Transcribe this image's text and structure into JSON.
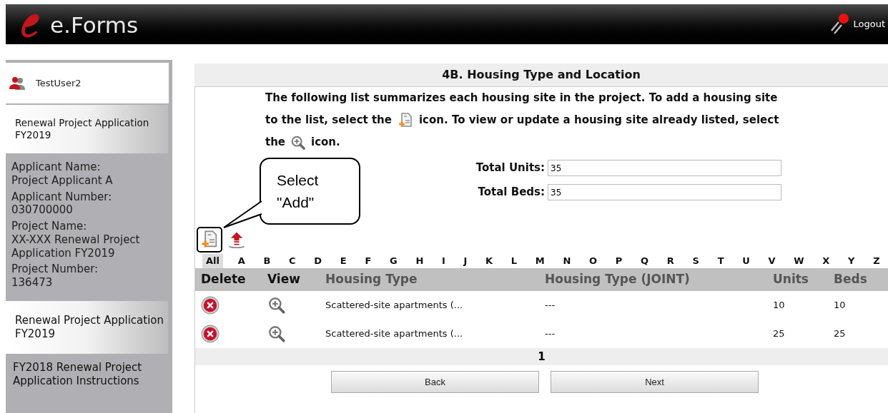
{
  "header": {
    "brand": "e.Forms",
    "logout": "Logout"
  },
  "sidebar": {
    "user": "TestUser2",
    "items": [
      {
        "kind": "link",
        "label": "Renewal Project Application FY2019"
      },
      {
        "kind": "info",
        "fields": [
          {
            "label": "Applicant Name:",
            "value": "Project Applicant A"
          },
          {
            "label": "Applicant Number:",
            "value": "030700000"
          },
          {
            "label": "Project Name:",
            "value": "XX-XXX Renewal Project Application FY2019"
          },
          {
            "label": "Project Number:",
            "value": "136473"
          }
        ]
      },
      {
        "kind": "link",
        "label": "Renewal Project Application FY2019"
      },
      {
        "kind": "plain",
        "label": "FY2018 Renewal Project Application Instructions"
      }
    ]
  },
  "main": {
    "title": "4B. Housing Type and Location",
    "intro": [
      [
        {
          "kind": "text",
          "text": "The following list summarizes each housing site in the project. To add a housing site"
        }
      ],
      [
        {
          "kind": "text",
          "text": "to the list, select the"
        },
        {
          "kind": "add_icon"
        },
        {
          "kind": "text",
          "text": "icon. To view or update a housing site already listed, select"
        }
      ],
      [
        {
          "kind": "text",
          "text": "the"
        },
        {
          "kind": "zoom_icon"
        },
        {
          "kind": "text",
          "text": "icon."
        }
      ]
    ],
    "totals": [
      {
        "label": "Total Units:",
        "value": "35"
      },
      {
        "label": "Total Beds:",
        "value": "35"
      }
    ],
    "callout": "Select \"Add\"",
    "letters": [
      {
        "label": "All",
        "selected": true
      },
      {
        "label": "A",
        "selected": false
      },
      {
        "label": "B",
        "selected": false
      },
      {
        "label": "C",
        "selected": false
      },
      {
        "label": "D",
        "selected": false
      },
      {
        "label": "E",
        "selected": false
      },
      {
        "label": "F",
        "selected": false
      },
      {
        "label": "G",
        "selected": false
      },
      {
        "label": "H",
        "selected": false
      },
      {
        "label": "I",
        "selected": false
      },
      {
        "label": "J",
        "selected": false
      },
      {
        "label": "K",
        "selected": false
      },
      {
        "label": "L",
        "selected": false
      },
      {
        "label": "M",
        "selected": false
      },
      {
        "label": "N",
        "selected": false
      },
      {
        "label": "O",
        "selected": false
      },
      {
        "label": "P",
        "selected": false
      },
      {
        "label": "Q",
        "selected": false
      },
      {
        "label": "R",
        "selected": false
      },
      {
        "label": "S",
        "selected": false
      },
      {
        "label": "T",
        "selected": false
      },
      {
        "label": "U",
        "selected": false
      },
      {
        "label": "V",
        "selected": false
      },
      {
        "label": "W",
        "selected": false
      },
      {
        "label": "X",
        "selected": false
      },
      {
        "label": "Y",
        "selected": false
      },
      {
        "label": "Z",
        "selected": false
      }
    ],
    "table": {
      "columns": [
        "Delete",
        "View",
        "Housing Type",
        "Housing Type (JOINT)",
        "Units",
        "Beds"
      ],
      "rows": [
        {
          "housing_type": "Scattered-site apartments (...",
          "joint": "---",
          "units": "10",
          "beds": "10"
        },
        {
          "housing_type": "Scattered-site apartments (...",
          "joint": "---",
          "units": "25",
          "beds": "25"
        }
      ]
    },
    "pager": "1",
    "buttons": [
      "Back",
      "Next"
    ]
  }
}
